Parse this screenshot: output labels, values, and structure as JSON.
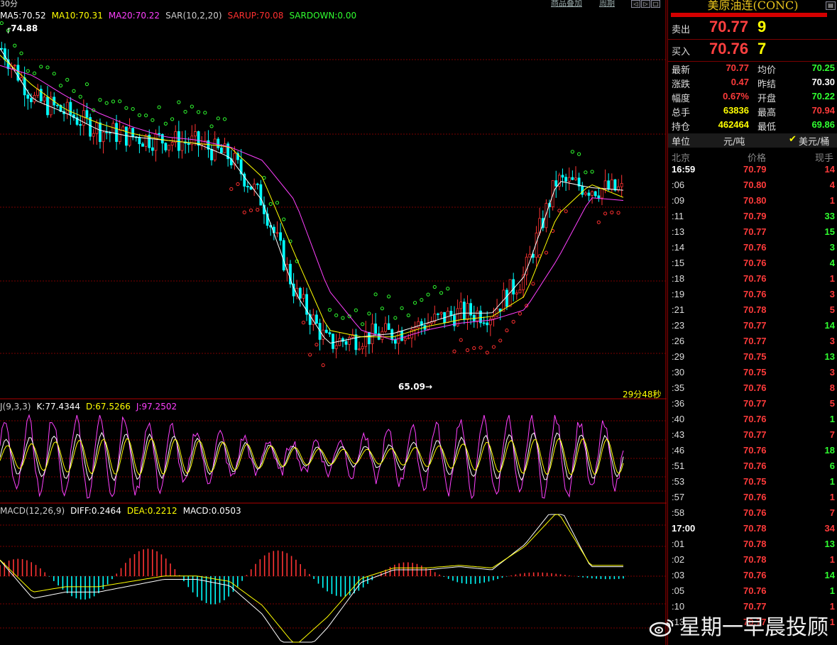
{
  "chart": {
    "period_tab": "30分",
    "top_buttons": [
      "商品叠加",
      "周期"
    ],
    "ma_legend": [
      {
        "text": "MA5:70.52",
        "color": "#ffffff"
      },
      {
        "text": "MA10:70.31",
        "color": "#ffff00"
      },
      {
        "text": "MA20:70.22",
        "color": "#ff40ff"
      },
      {
        "text": "SAR(10,2,20)",
        "color": "#cccccc"
      },
      {
        "text": "SARUP:70.08",
        "color": "#ff3030"
      },
      {
        "text": "SARDOWN:0.00",
        "color": "#30ff30"
      }
    ],
    "kdj_legend": [
      {
        "text": "J(9,3,3)",
        "color": "#cccccc"
      },
      {
        "text": "K:77.4344",
        "color": "#ffffff"
      },
      {
        "text": "D:67.5266",
        "color": "#ffff00"
      },
      {
        "text": "J:97.2502",
        "color": "#ff40ff"
      }
    ],
    "macd_legend": [
      {
        "text": "MACD(12,26,9)",
        "color": "#cccccc"
      },
      {
        "text": "DIFF:0.2464",
        "color": "#ffffff"
      },
      {
        "text": "DEA:0.2212",
        "color": "#ffff00"
      },
      {
        "text": "MACD:0.0503",
        "color": "#ffffff"
      }
    ],
    "high_label": "74.88",
    "low_label": "65.09",
    "countdown": "29分48秒",
    "colors": {
      "up": "#ff3333",
      "down": "#00ffff",
      "grid": "#7a0000",
      "sar_up": "#ff3030",
      "sar_down": "#30ff30"
    }
  },
  "chart_data": {
    "type": "line",
    "title": "",
    "xlabel": "",
    "ylabel": "",
    "ylim": [
      64.5,
      75.5
    ],
    "x": [
      0,
      10,
      20,
      30,
      40,
      50,
      60,
      70,
      80,
      90,
      100,
      110,
      120,
      130,
      140,
      150,
      160,
      170,
      180,
      190
    ],
    "series": [
      {
        "name": "MA5",
        "values": [
          74.7,
          73.2,
          72.8,
          72.3,
          72.1,
          72.0,
          71.9,
          71.5,
          70.2,
          67.5,
          66.0,
          66.2,
          66.3,
          66.6,
          66.9,
          66.9,
          68.0,
          70.8,
          70.6,
          70.52
        ]
      },
      {
        "name": "MA10",
        "values": [
          74.5,
          73.6,
          72.9,
          72.5,
          72.2,
          72.0,
          71.9,
          71.8,
          70.9,
          68.6,
          66.4,
          66.2,
          66.2,
          66.5,
          66.7,
          66.8,
          67.4,
          69.8,
          70.7,
          70.31
        ]
      },
      {
        "name": "MA20",
        "values": [
          74.2,
          73.9,
          73.3,
          72.8,
          72.4,
          72.1,
          72.0,
          71.8,
          71.4,
          70.2,
          67.6,
          66.4,
          66.1,
          66.4,
          66.6,
          66.7,
          67.0,
          68.5,
          70.3,
          70.22
        ]
      }
    ]
  },
  "side": {
    "title": "美原油连(CONC)",
    "sell": {
      "label": "卖出",
      "price": "70.77",
      "vol": "9"
    },
    "buy": {
      "label": "买入",
      "price": "70.76",
      "vol": "7"
    },
    "stats": [
      {
        "l1": "最新",
        "v1": "70.77",
        "c1": "#ff3b3b",
        "l2": "均价",
        "v2": "70.25",
        "c2": "#30ff30"
      },
      {
        "l1": "涨跌",
        "v1": "0.47",
        "c1": "#ff3b3b",
        "l2": "昨结",
        "v2": "70.30",
        "c2": "#ffffff"
      },
      {
        "l1": "幅度",
        "v1": "0.67%",
        "c1": "#ff3b3b",
        "l2": "开盘",
        "v2": "70.22",
        "c2": "#30ff30"
      },
      {
        "l1": "总手",
        "v1": "63836",
        "c1": "#ffff00",
        "l2": "最高",
        "v2": "70.94",
        "c2": "#ff3b3b"
      },
      {
        "l1": "持仓",
        "v1": "462464",
        "c1": "#ffff00",
        "l2": "最低",
        "v2": "69.86",
        "c2": "#30ff30"
      }
    ],
    "unit_label": "单位",
    "unit_opt1": "元/吨",
    "unit_opt2": "美元/桶",
    "tick_headers": [
      "北京",
      "价格",
      "现手"
    ],
    "ticks": [
      {
        "t": "16:59",
        "p": "70.79",
        "v": "14",
        "vc": "#ff3b3b",
        "full": true
      },
      {
        "t": ":06",
        "p": "70.80",
        "v": "4",
        "vc": "#ff3b3b"
      },
      {
        "t": ":09",
        "p": "70.80",
        "v": "1",
        "vc": "#ff3b3b"
      },
      {
        "t": ":11",
        "p": "70.79",
        "v": "33",
        "vc": "#30ff30"
      },
      {
        "t": ":13",
        "p": "70.77",
        "v": "15",
        "vc": "#30ff30"
      },
      {
        "t": ":14",
        "p": "70.76",
        "v": "3",
        "vc": "#30ff30"
      },
      {
        "t": ":15",
        "p": "70.76",
        "v": "4",
        "vc": "#30ff30"
      },
      {
        "t": ":18",
        "p": "70.76",
        "v": "1",
        "vc": "#ff3b3b"
      },
      {
        "t": ":19",
        "p": "70.76",
        "v": "3",
        "vc": "#ff3b3b"
      },
      {
        "t": ":21",
        "p": "70.78",
        "v": "5",
        "vc": "#ff3b3b"
      },
      {
        "t": ":23",
        "p": "70.77",
        "v": "14",
        "vc": "#30ff30"
      },
      {
        "t": ":26",
        "p": "70.77",
        "v": "3",
        "vc": "#ff3b3b"
      },
      {
        "t": ":29",
        "p": "70.75",
        "v": "13",
        "vc": "#30ff30"
      },
      {
        "t": ":30",
        "p": "70.75",
        "v": "3",
        "vc": "#ff3b3b"
      },
      {
        "t": ":35",
        "p": "70.76",
        "v": "8",
        "vc": "#ff3b3b"
      },
      {
        "t": ":36",
        "p": "70.77",
        "v": "5",
        "vc": "#ff3b3b"
      },
      {
        "t": ":40",
        "p": "70.76",
        "v": "1",
        "vc": "#30ff30"
      },
      {
        "t": ":43",
        "p": "70.77",
        "v": "7",
        "vc": "#ff3b3b"
      },
      {
        "t": ":46",
        "p": "70.76",
        "v": "18",
        "vc": "#30ff30"
      },
      {
        "t": ":51",
        "p": "70.76",
        "v": "6",
        "vc": "#30ff30"
      },
      {
        "t": ":53",
        "p": "70.75",
        "v": "1",
        "vc": "#30ff30"
      },
      {
        "t": ":57",
        "p": "70.76",
        "v": "1",
        "vc": "#ff3b3b"
      },
      {
        "t": ":58",
        "p": "70.76",
        "v": "7",
        "vc": "#ff3b3b"
      },
      {
        "t": "17:00",
        "p": "70.78",
        "v": "34",
        "vc": "#ff3b3b",
        "full": true
      },
      {
        "t": ":01",
        "p": "70.78",
        "v": "13",
        "vc": "#30ff30"
      },
      {
        "t": ":02",
        "p": "70.78",
        "v": "1",
        "vc": "#ff3b3b"
      },
      {
        "t": ":03",
        "p": "70.76",
        "v": "14",
        "vc": "#30ff30"
      },
      {
        "t": ":05",
        "p": "70.76",
        "v": "1",
        "vc": "#30ff30"
      },
      {
        "t": ":10",
        "p": "70.77",
        "v": "1",
        "vc": "#ff3b3b"
      },
      {
        "t": ":13",
        "p": "70.77",
        "v": "1",
        "vc": "#ff3b3b"
      }
    ]
  },
  "watermark": "星期一早晨投顾"
}
